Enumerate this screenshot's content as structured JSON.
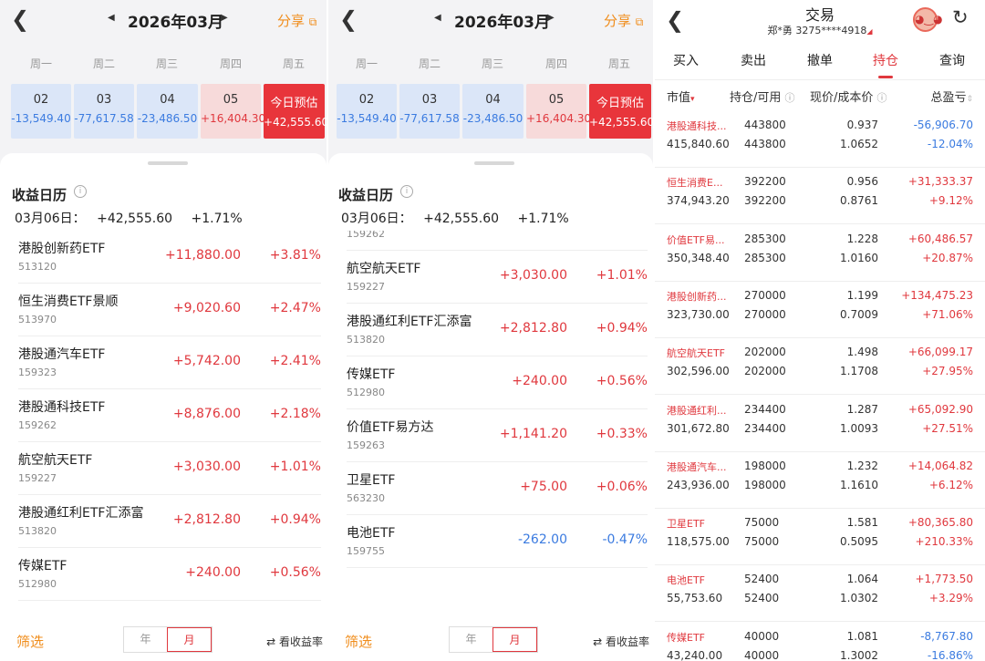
{
  "calendar": {
    "back_icon": "chevron-left-icon",
    "prev_icon": "triangle-left-icon",
    "next_icon": "triangle-right-icon",
    "month": "2026年03月",
    "share_label": "分享",
    "share_icon": "external-share-icon",
    "weekdays": [
      "周一",
      "周二",
      "周三",
      "周四",
      "周五"
    ],
    "days": [
      {
        "date": "02",
        "value": "-13,549.40"
      },
      {
        "date": "03",
        "value": "-77,617.58"
      },
      {
        "date": "04",
        "value": "-23,486.50"
      },
      {
        "date": "05",
        "value": "+16,404.30"
      },
      {
        "date": "今日预估",
        "value": "+42,555.60"
      }
    ],
    "section_title": "收益日历",
    "info_icon": "info-icon",
    "date_label": "03月06日：",
    "day_total": "+42,555.60",
    "day_pct": "+1.71%",
    "items_left": [
      {
        "name": "港股创新药ETF",
        "code": "513120",
        "amount": "+11,880.00",
        "pct": "+3.81%"
      },
      {
        "name": "恒生消费ETF景顺",
        "code": "513970",
        "amount": "+9,020.60",
        "pct": "+2.47%"
      },
      {
        "name": "港股通汽车ETF",
        "code": "159323",
        "amount": "+5,742.00",
        "pct": "+2.41%"
      },
      {
        "name": "港股通科技ETF",
        "code": "159262",
        "amount": "+8,876.00",
        "pct": "+2.18%"
      },
      {
        "name": "航空航天ETF",
        "code": "159227",
        "amount": "+3,030.00",
        "pct": "+1.01%"
      },
      {
        "name": "港股通红利ETF汇添富",
        "code": "513820",
        "amount": "+2,812.80",
        "pct": "+0.94%"
      },
      {
        "name": "传媒ETF",
        "code": "512980",
        "amount": "+240.00",
        "pct": "+0.56%"
      }
    ],
    "items_right": [
      {
        "name": "港股通科技ETF",
        "code": "159262",
        "amount": "+8,876.00",
        "pct": "+2.18%"
      },
      {
        "name": "航空航天ETF",
        "code": "159227",
        "amount": "+3,030.00",
        "pct": "+1.01%"
      },
      {
        "name": "港股通红利ETF汇添富",
        "code": "513820",
        "amount": "+2,812.80",
        "pct": "+0.94%"
      },
      {
        "name": "传媒ETF",
        "code": "512980",
        "amount": "+240.00",
        "pct": "+0.56%"
      },
      {
        "name": "价值ETF易方达",
        "code": "159263",
        "amount": "+1,141.20",
        "pct": "+0.33%"
      },
      {
        "name": "卫星ETF",
        "code": "563230",
        "amount": "+75.00",
        "pct": "+0.06%"
      },
      {
        "name": "电池ETF",
        "code": "159755",
        "amount": "-262.00",
        "pct": "-0.47%"
      }
    ],
    "filter_label": "筛选",
    "year_label": "年",
    "month_label": "月",
    "rate_label": "看收益率",
    "swap_icon": "swap-arrows-icon"
  },
  "trade": {
    "back_icon": "chevron-left-icon",
    "title": "交易",
    "account": "郑*勇 3275****4918",
    "avatar_icon": "avatar-icon",
    "refresh_icon": "refresh-icon",
    "tabs": [
      "买入",
      "卖出",
      "撤单",
      "持仓",
      "查询"
    ],
    "active_tab": "持仓",
    "headers": {
      "market_value": "市值",
      "position": "持仓/可用",
      "price": "现价/成本价",
      "pl": "总盈亏"
    },
    "holdings": [
      {
        "name": "港股通科技...",
        "mv": "415,840.60",
        "qty": "443800",
        "avail": "443800",
        "price": "0.937",
        "cost": "1.0652",
        "pl": "-56,906.70",
        "plpct": "-12.04%"
      },
      {
        "name": "恒生消费E...",
        "mv": "374,943.20",
        "qty": "392200",
        "avail": "392200",
        "price": "0.956",
        "cost": "0.8761",
        "pl": "+31,333.37",
        "plpct": "+9.12%"
      },
      {
        "name": "价值ETF易...",
        "mv": "350,348.40",
        "qty": "285300",
        "avail": "285300",
        "price": "1.228",
        "cost": "1.0160",
        "pl": "+60,486.57",
        "plpct": "+20.87%"
      },
      {
        "name": "港股创新药...",
        "mv": "323,730.00",
        "qty": "270000",
        "avail": "270000",
        "price": "1.199",
        "cost": "0.7009",
        "pl": "+134,475.23",
        "plpct": "+71.06%"
      },
      {
        "name": "航空航天ETF",
        "mv": "302,596.00",
        "qty": "202000",
        "avail": "202000",
        "price": "1.498",
        "cost": "1.1708",
        "pl": "+66,099.17",
        "plpct": "+27.95%"
      },
      {
        "name": "港股通红利...",
        "mv": "301,672.80",
        "qty": "234400",
        "avail": "234400",
        "price": "1.287",
        "cost": "1.0093",
        "pl": "+65,092.90",
        "plpct": "+27.51%"
      },
      {
        "name": "港股通汽车...",
        "mv": "243,936.00",
        "qty": "198000",
        "avail": "198000",
        "price": "1.232",
        "cost": "1.1610",
        "pl": "+14,064.82",
        "plpct": "+6.12%"
      },
      {
        "name": "卫星ETF",
        "mv": "118,575.00",
        "qty": "75000",
        "avail": "75000",
        "price": "1.581",
        "cost": "0.5095",
        "pl": "+80,365.80",
        "plpct": "+210.33%"
      },
      {
        "name": "电池ETF",
        "mv": "55,753.60",
        "qty": "52400",
        "avail": "52400",
        "price": "1.064",
        "cost": "1.0302",
        "pl": "+1,773.50",
        "plpct": "+3.29%"
      },
      {
        "name": "传媒ETF",
        "mv": "43,240.00",
        "qty": "40000",
        "avail": "40000",
        "price": "1.081",
        "cost": "1.3002",
        "pl": "-8,767.80",
        "plpct": "-16.86%"
      }
    ]
  },
  "colors": {
    "up": "#e0383e",
    "down": "#3b7be0",
    "accent": "#f08c1a"
  }
}
